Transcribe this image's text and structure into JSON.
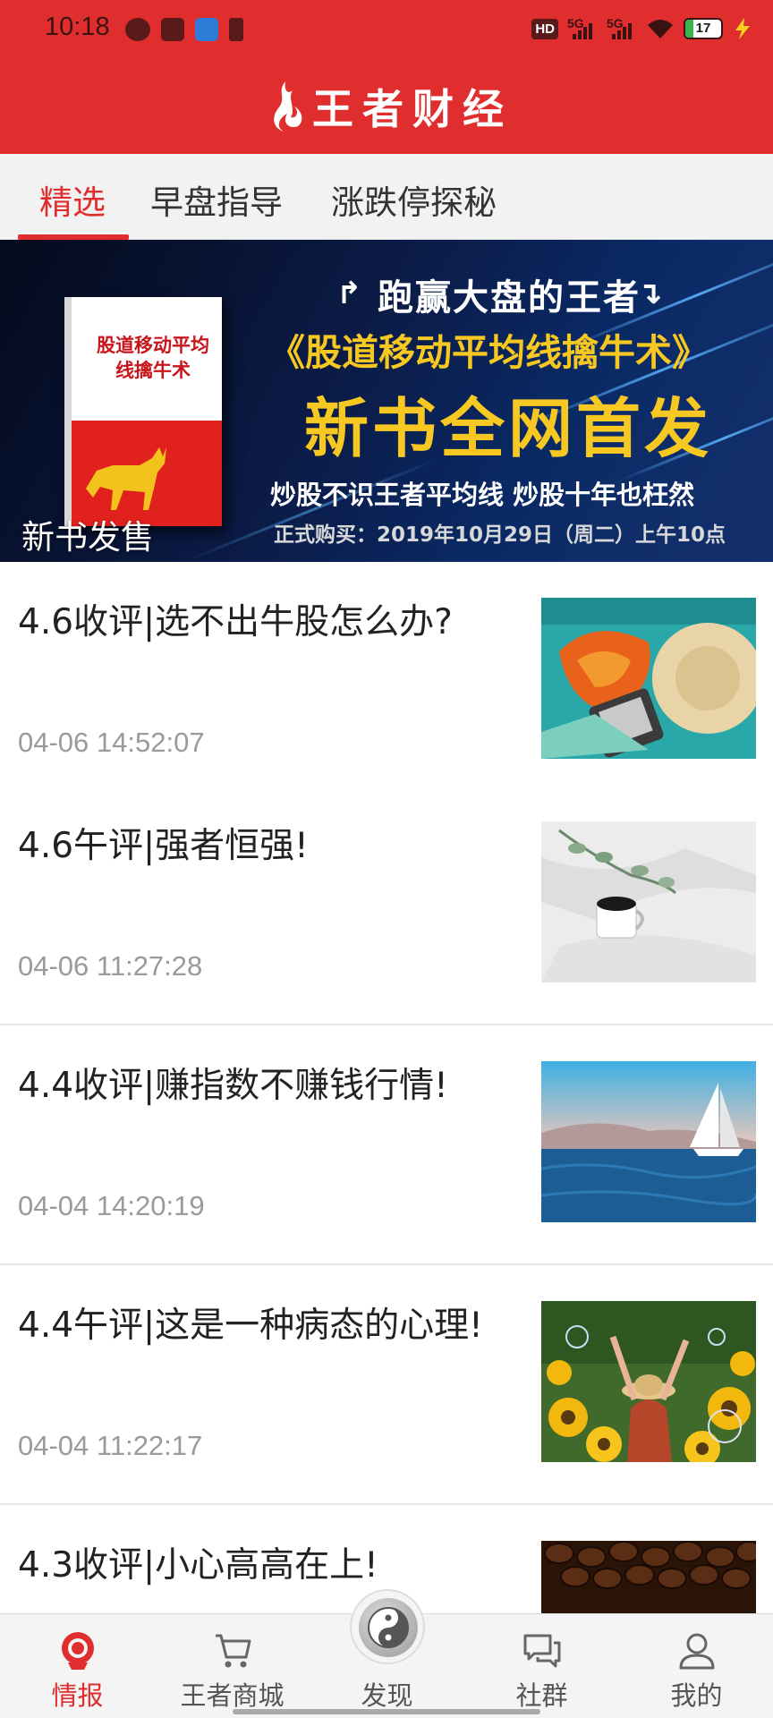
{
  "status_bar": {
    "time": "10:18",
    "hd_label": "HD",
    "signal1_label": "5G",
    "signal2_label": "5G",
    "battery_level": "17"
  },
  "header": {
    "app_name": "王者财经"
  },
  "tabs": [
    {
      "label": "精选",
      "active": true
    },
    {
      "label": "早盘指导",
      "active": false
    },
    {
      "label": "涨跌停探秘",
      "active": false
    }
  ],
  "banner": {
    "headline": "跑赢大盘的王者",
    "book_title": "《股道移动平均线擒牛术》",
    "main_slogan": "新书全网首发",
    "sub_slogan": "炒股不识王者平均线  炒股十年也枉然",
    "purchase_info": "正式购买：2019年10月29日（周二）上午10点",
    "cover_title": "股道移动平均线擒牛术",
    "caption": "新书发售"
  },
  "articles": [
    {
      "title": "4.6收评|选不出牛股怎么办?",
      "time": "04-06 14:52:07",
      "thumb": "beach-items-photo"
    },
    {
      "title": "4.6午评|强者恒强!",
      "time": "04-06 11:27:28",
      "thumb": "coffee-on-sheets-photo"
    },
    {
      "title": "4.4收评|赚指数不赚钱行情!",
      "time": "04-04 14:20:19",
      "thumb": "sailboat-sea-photo"
    },
    {
      "title": "4.4午评|这是一种病态的心理!",
      "time": "04-04 11:22:17",
      "thumb": "sunflower-field-photo"
    },
    {
      "title": "4.3收评|小心高高在上!",
      "time": "",
      "thumb": "coffee-beans-photo"
    }
  ],
  "bottom_nav": [
    {
      "label": "情报",
      "icon": "news-icon",
      "active": true
    },
    {
      "label": "王者商城",
      "icon": "cart-icon",
      "active": false
    },
    {
      "label": "发现",
      "icon": "yin-yang-icon",
      "active": false
    },
    {
      "label": "社群",
      "icon": "chat-icon",
      "active": false
    },
    {
      "label": "我的",
      "icon": "profile-icon",
      "active": false
    }
  ],
  "colors": {
    "brand_red": "#e02e2e",
    "banner_gold": "#f7c821",
    "text_gray": "#9a9a9a"
  }
}
